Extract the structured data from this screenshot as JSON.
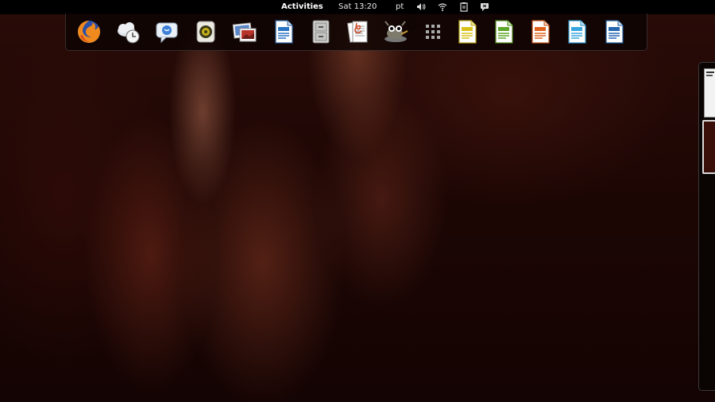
{
  "topbar": {
    "activities_label": "Activities",
    "clock": "Sat 13:20",
    "keyboard_layout": "pt",
    "tray_icons": [
      "volume-icon",
      "wifi-icon",
      "clipboard-icon",
      "chat-status-icon"
    ]
  },
  "dash": {
    "apps": [
      {
        "name": "firefox-icon"
      },
      {
        "name": "weather-clock-icon"
      },
      {
        "name": "empathy-chat-icon"
      },
      {
        "name": "rhythmbox-icon"
      },
      {
        "name": "image-viewer-icon"
      },
      {
        "name": "libreoffice-writer-icon"
      },
      {
        "name": "file-cabinet-icon"
      },
      {
        "name": "document-viewer-icon"
      },
      {
        "name": "gimp-icon"
      },
      {
        "name": "show-applications-icon"
      },
      {
        "name": "libreoffice-impress-yellow-icon"
      },
      {
        "name": "libreoffice-calc-icon"
      },
      {
        "name": "libreoffice-impress-icon"
      },
      {
        "name": "libreoffice-draw-icon"
      },
      {
        "name": "libreoffice-writer-2-icon"
      }
    ]
  },
  "colors": {
    "topbar_bg": "#000000",
    "dash_bg": "#0c0403",
    "wallpaper_dark": "#1a0604",
    "wallpaper_light": "#8a4a38"
  }
}
